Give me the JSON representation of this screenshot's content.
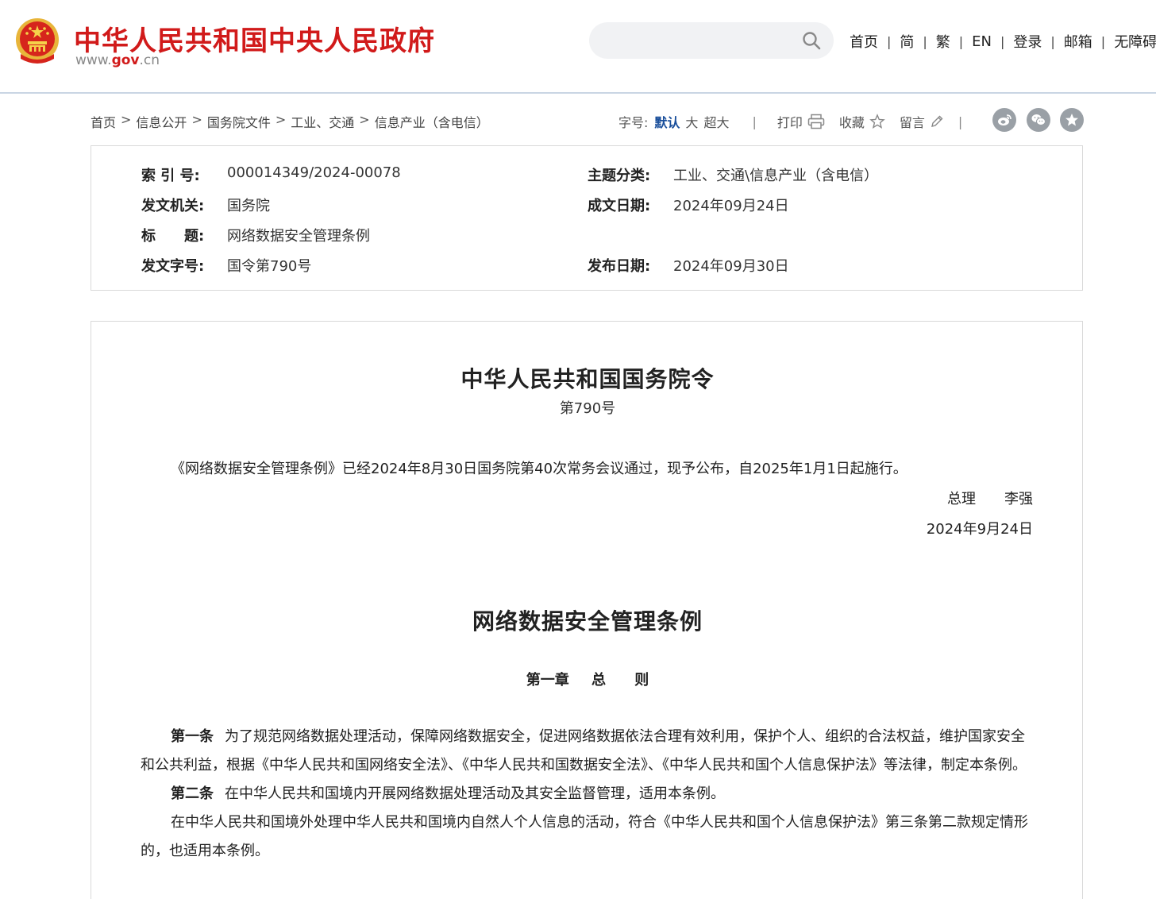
{
  "header": {
    "site_title": "中华人民共和国中央人民政府",
    "site_url_prefix": "www.",
    "site_url_gov": "gov",
    "site_url_suffix": ".cn",
    "search_placeholder": "",
    "nav": [
      "首页",
      "简",
      "繁",
      "EN",
      "登录",
      "邮箱",
      "无障碍"
    ],
    "brand_color": "#d11a1a"
  },
  "breadcrumb": [
    "首页",
    "信息公开",
    "国务院文件",
    "工业、交通",
    "信息产业（含电信）"
  ],
  "tools": {
    "font_size_label": "字号:",
    "font_sizes": [
      "默认",
      "大",
      "超大"
    ],
    "print": "打印",
    "favorite": "收藏",
    "comment": "留言",
    "share_icons": [
      "weibo-icon",
      "wechat-icon",
      "star-icon"
    ]
  },
  "info": {
    "index_label": "索 引 号:",
    "index_value": "000014349/2024-00078",
    "topic_label": "主题分类:",
    "topic_value": "工业、交通\\信息产业（含电信）",
    "issuer_label": "发文机关:",
    "issuer_value": "国务院",
    "date_written_label": "成文日期:",
    "date_written_value": "2024年09月24日",
    "title_label": "标　　题:",
    "title_value": "网络数据安全管理条例",
    "doc_no_label": "发文字号:",
    "doc_no_value": "国令第790号",
    "publish_date_label": "发布日期:",
    "publish_date_value": "2024年09月30日"
  },
  "article": {
    "order_title": "中华人民共和国国务院令",
    "order_no": "第790号",
    "promulgation": "《网络数据安全管理条例》已经2024年8月30日国务院第40次常务会议通过，现予公布，自2025年1月1日起施行。",
    "signer": "总理　　李强",
    "sign_date": "2024年9月24日",
    "law_title": "网络数据安全管理条例",
    "chapter_no": "第一章",
    "chapter_name_1": "总",
    "chapter_name_2": "则",
    "art1_label": "第一条",
    "art1_text": "为了规范网络数据处理活动，保障网络数据安全，促进网络数据依法合理有效利用，保护个人、组织的合法权益，维护国家安全和公共利益，根据《中华人民共和国网络安全法》、《中华人民共和国数据安全法》、《中华人民共和国个人信息保护法》等法律，制定本条例。",
    "art2_label": "第二条",
    "art2_text": "在中华人民共和国境内开展网络数据处理活动及其安全监督管理，适用本条例。",
    "art2_para2": "在中华人民共和国境外处理中华人民共和国境内自然人个人信息的活动，符合《中华人民共和国个人信息保护法》第三条第二款规定情形的，也适用本条例。"
  }
}
